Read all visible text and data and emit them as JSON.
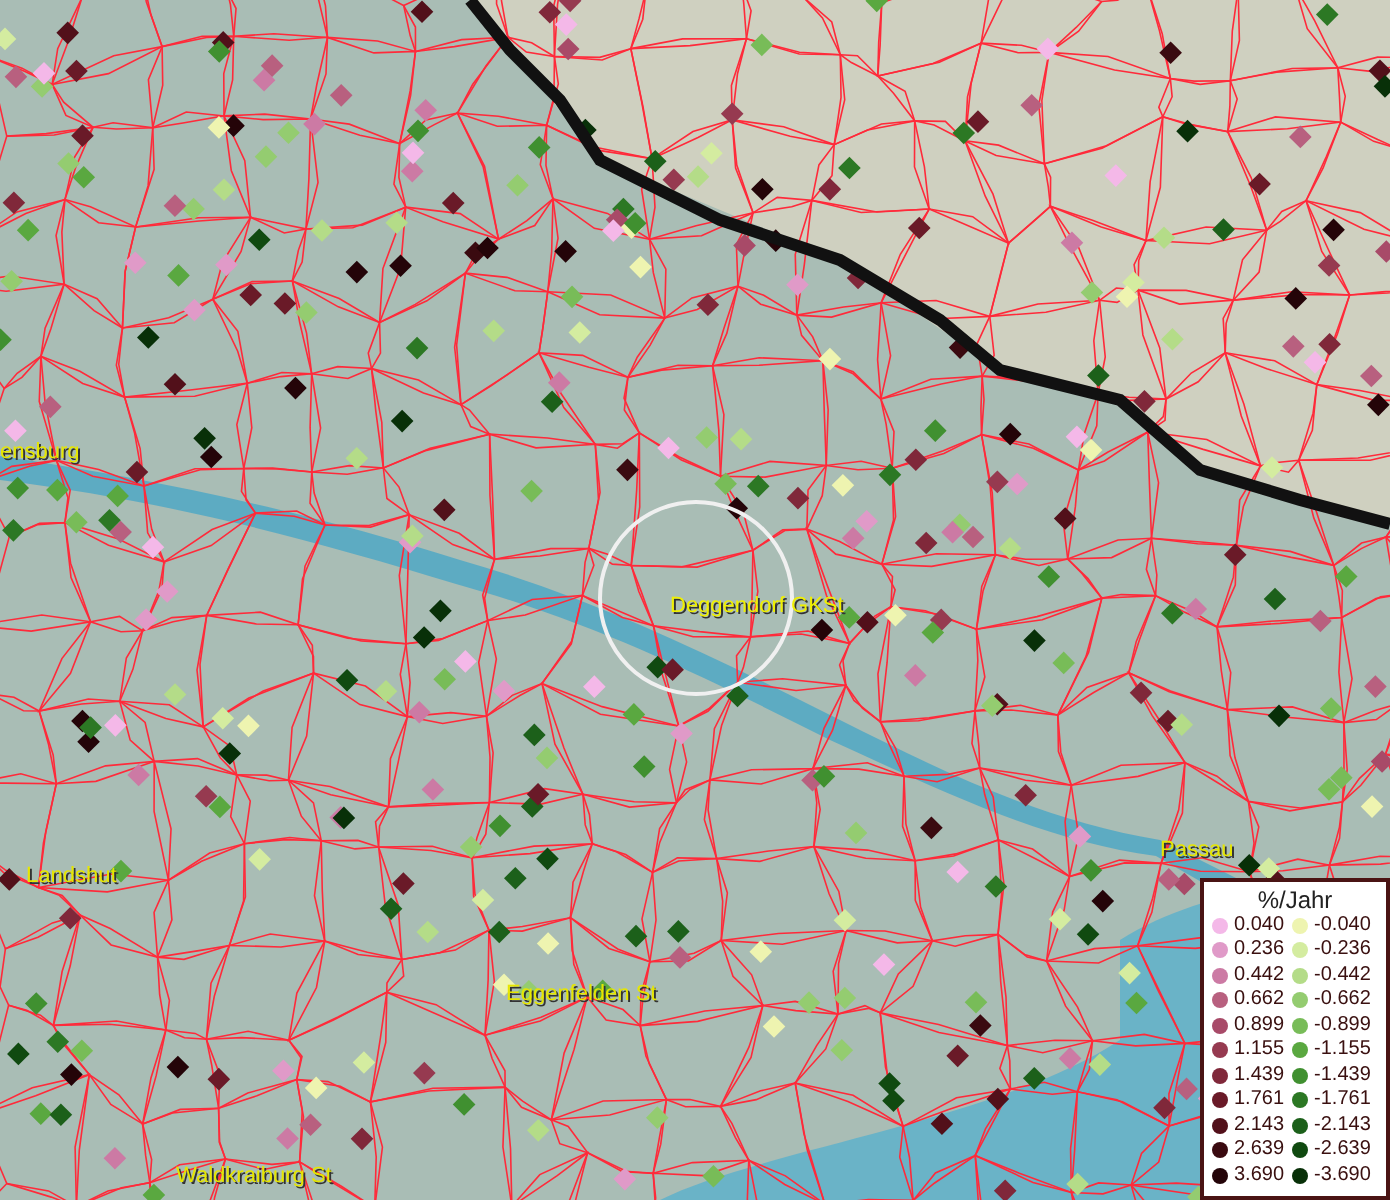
{
  "map": {
    "places": [
      {
        "name": "ensburg",
        "kind": "town"
      },
      {
        "name": "Deggendorf GKSt",
        "kind": "selected"
      },
      {
        "name": "Landshut",
        "kind": "town"
      },
      {
        "name": "Passau",
        "kind": "town"
      },
      {
        "name": "Eggenfelden St",
        "kind": "town"
      },
      {
        "name": "Waldkraiburg St",
        "kind": "town"
      }
    ]
  },
  "legend": {
    "title": "%/Jahr",
    "positive": [
      {
        "label": "0.040",
        "color": "#f4b8e8"
      },
      {
        "label": "0.236",
        "color": "#e09ac8"
      },
      {
        "label": "0.442",
        "color": "#cc7aa4"
      },
      {
        "label": "0.662",
        "color": "#b8607f"
      },
      {
        "label": "0.899",
        "color": "#a84a68"
      },
      {
        "label": "1.155",
        "color": "#963a50"
      },
      {
        "label": "1.439",
        "color": "#80283a"
      },
      {
        "label": "1.761",
        "color": "#6a1a28"
      },
      {
        "label": "2.143",
        "color": "#52101a"
      },
      {
        "label": "2.639",
        "color": "#3a0a10"
      },
      {
        "label": "3.690",
        "color": "#240408"
      }
    ],
    "negative": [
      {
        "label": "-0.040",
        "color": "#eef4b0"
      },
      {
        "label": "-0.236",
        "color": "#d4eca0"
      },
      {
        "label": "-0.442",
        "color": "#b4dc88"
      },
      {
        "label": "-0.662",
        "color": "#94cc70"
      },
      {
        "label": "-0.899",
        "color": "#78bc58"
      },
      {
        "label": "-1.155",
        "color": "#5aa840"
      },
      {
        "label": "-1.439",
        "color": "#409030"
      },
      {
        "label": "-1.761",
        "color": "#2c7824"
      },
      {
        "label": "-2.143",
        "color": "#1c601a"
      },
      {
        "label": "-2.639",
        "color": "#104a10"
      },
      {
        "label": "-3.690",
        "color": "#083008"
      }
    ]
  }
}
